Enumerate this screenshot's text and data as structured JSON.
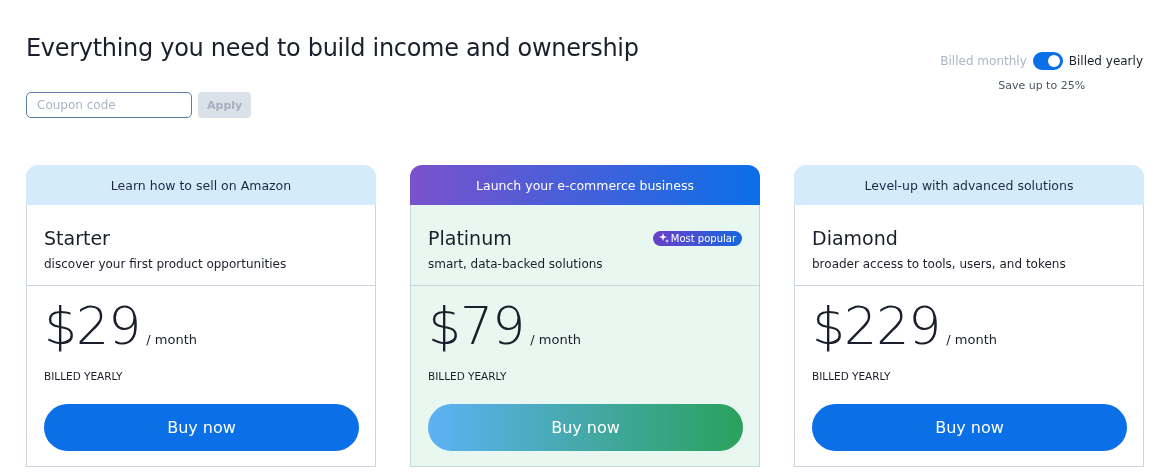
{
  "title": "Everything you need to build income and ownership",
  "coupon": {
    "placeholder": "Coupon code",
    "button": "Apply",
    "disabled": true
  },
  "billing": {
    "monthly_label": "Billed monthly",
    "yearly_label": "Billed yearly",
    "yearly": true,
    "note": "Save up to 25%"
  },
  "plans": [
    {
      "banner": "Learn how to sell on Amazon",
      "name": "Starter",
      "description": "discover your first product opportunities",
      "price": "$29",
      "period": "/ month",
      "billing": "BILLED YEARLY",
      "button": "Buy now",
      "featured": false
    },
    {
      "banner": "Launch your e-commerce business",
      "name": "Platinum",
      "badge": "Most popular",
      "description": "smart, data-backed solutions",
      "price": "$79",
      "period": "/ month",
      "billing": "BILLED YEARLY",
      "button": "Buy now",
      "featured": true
    },
    {
      "banner": "Level-up with advanced solutions",
      "name": "Diamond",
      "description": "broader access to tools, users, and tokens",
      "price": "$229",
      "period": "/ month",
      "billing": "BILLED YEARLY",
      "button": "Buy now",
      "featured": false
    }
  ]
}
